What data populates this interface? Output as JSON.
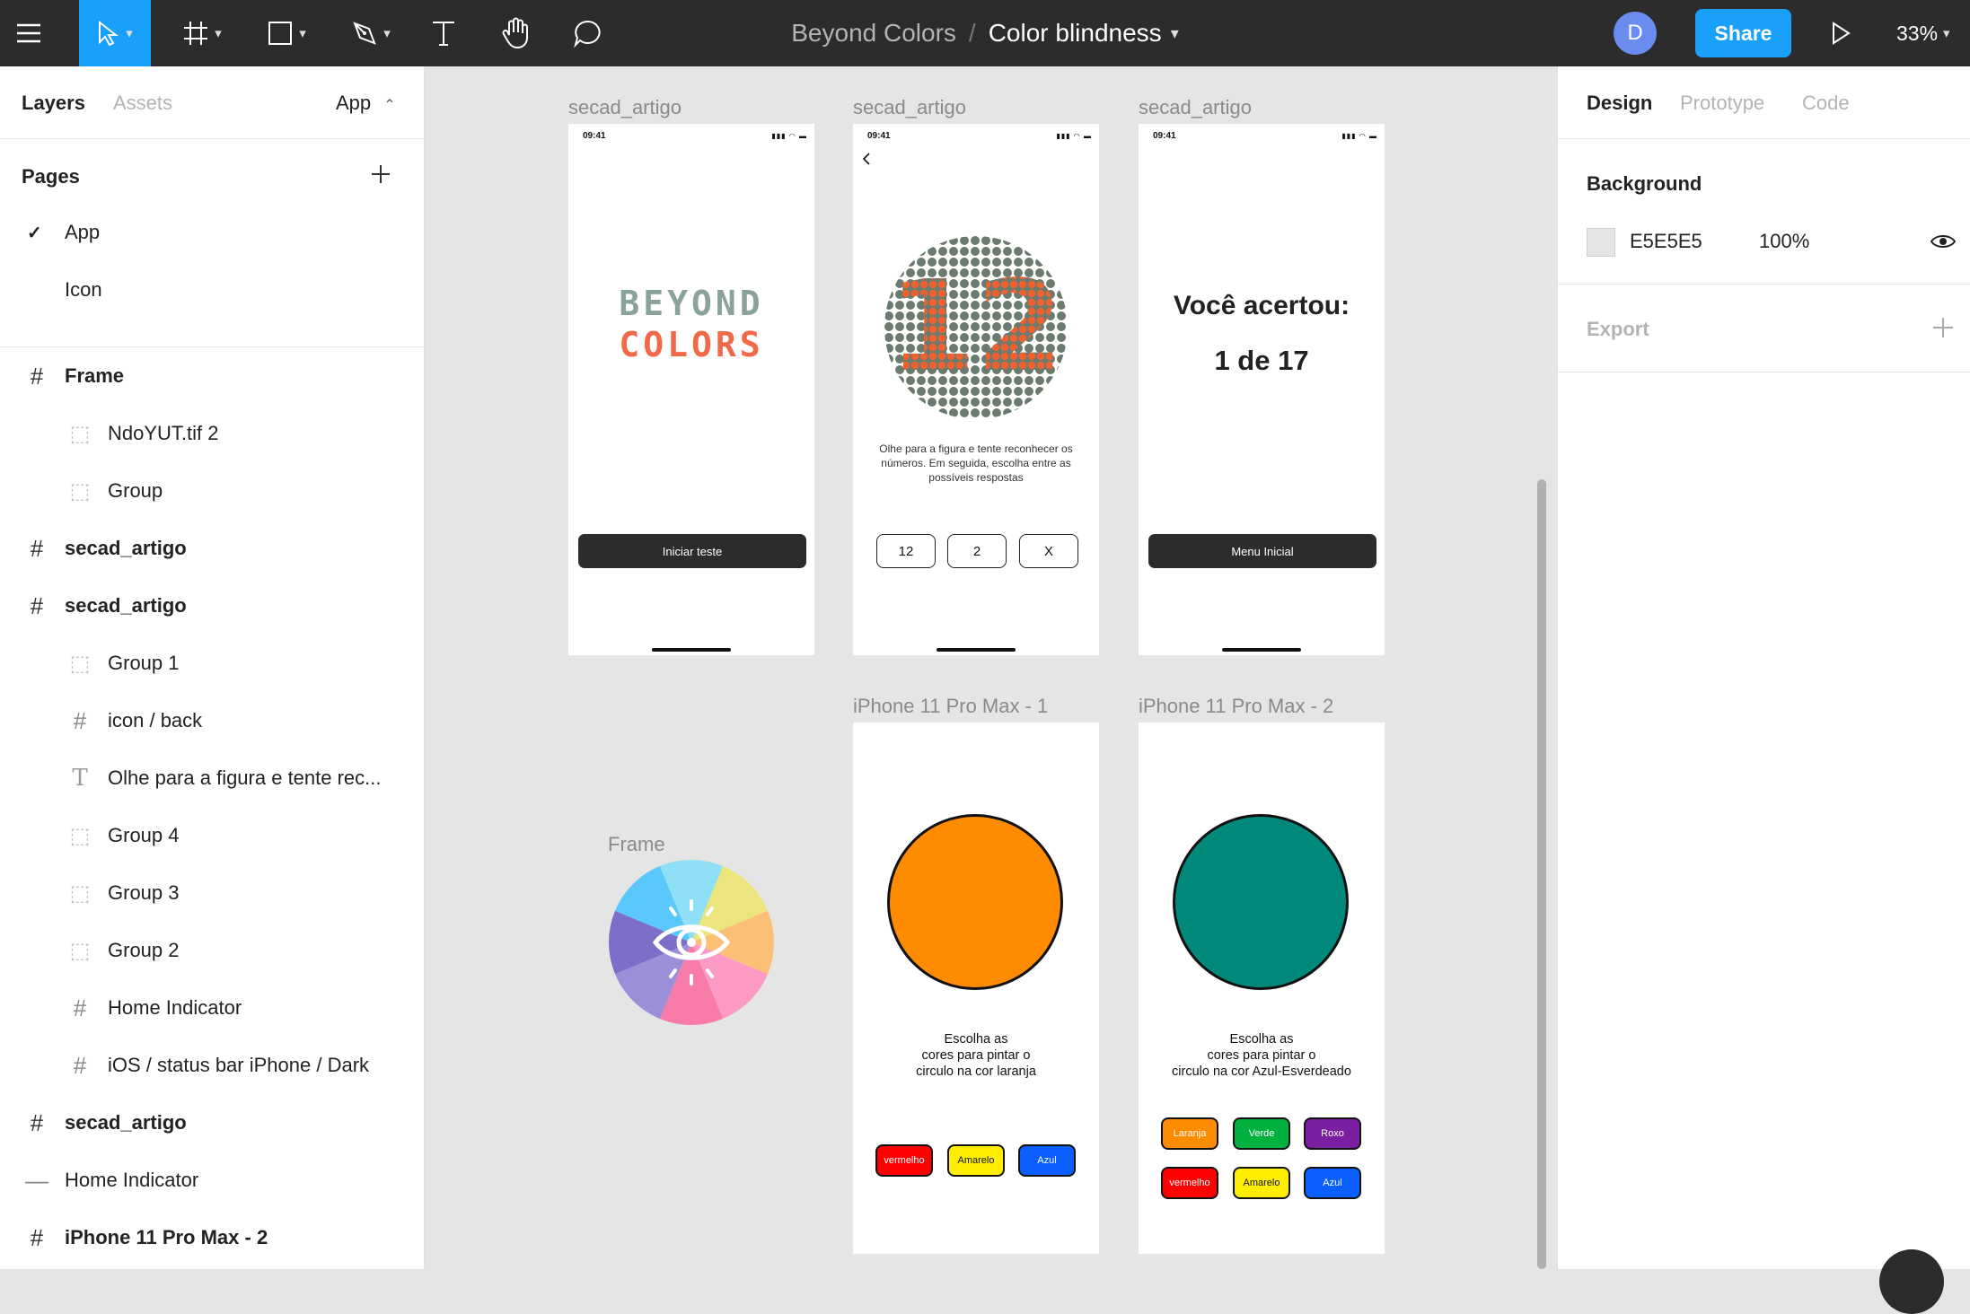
{
  "toolbar": {
    "project": "Beyond Colors",
    "separator": "/",
    "file": "Color blindness",
    "avatar": "D",
    "share": "Share",
    "zoom": "33%"
  },
  "left": {
    "tabs": [
      "Layers",
      "Assets"
    ],
    "page_selector": "App",
    "pages_title": "Pages",
    "pages": [
      {
        "label": "App",
        "checked": true
      },
      {
        "label": "Icon",
        "checked": false
      }
    ],
    "layers": [
      {
        "label": "Frame",
        "icon": "frame",
        "indent": 0,
        "bold": true
      },
      {
        "label": "NdoYUT.tif 2",
        "icon": "group",
        "indent": 1,
        "bold": false
      },
      {
        "label": "Group",
        "icon": "group",
        "indent": 1,
        "bold": false
      },
      {
        "label": "secad_artigo",
        "icon": "frame",
        "indent": 0,
        "bold": true
      },
      {
        "label": "secad_artigo",
        "icon": "frame",
        "indent": 0,
        "bold": true
      },
      {
        "label": "Group 1",
        "icon": "group",
        "indent": 1,
        "bold": false
      },
      {
        "label": "icon / back",
        "icon": "frame",
        "indent": 1,
        "bold": false
      },
      {
        "label": "Olhe para a figura e tente rec...",
        "icon": "text",
        "indent": 1,
        "bold": false
      },
      {
        "label": "Group 4",
        "icon": "group",
        "indent": 1,
        "bold": false
      },
      {
        "label": "Group 3",
        "icon": "group",
        "indent": 1,
        "bold": false
      },
      {
        "label": "Group 2",
        "icon": "group",
        "indent": 1,
        "bold": false
      },
      {
        "label": "Home Indicator",
        "icon": "frame",
        "indent": 1,
        "bold": false
      },
      {
        "label": "iOS / status bar iPhone / Dark",
        "icon": "frame",
        "indent": 1,
        "bold": false
      },
      {
        "label": "secad_artigo",
        "icon": "frame",
        "indent": 0,
        "bold": true
      },
      {
        "label": "Home Indicator",
        "icon": "line",
        "indent": 0,
        "bold": false
      },
      {
        "label": "iPhone 11 Pro Max - 2",
        "icon": "frame",
        "indent": 0,
        "bold": true
      }
    ]
  },
  "right": {
    "tabs": [
      "Design",
      "Prototype",
      "Code"
    ],
    "background_title": "Background",
    "bg_hex": "E5E5E5",
    "bg_opacity": "100%",
    "export_title": "Export"
  },
  "canvas": {
    "frame_labels": [
      "secad_artigo",
      "secad_artigo",
      "secad_artigo",
      "iPhone 11 Pro Max - 1",
      "iPhone 11 Pro Max - 2",
      "Frame"
    ],
    "status_time": "09:41",
    "screen1": {
      "logo_line1": "BEYOND",
      "logo_line2": "COLORS",
      "button": "Iniciar teste"
    },
    "screen2": {
      "plate_number": "12",
      "instructions": "Olhe para a figura e tente reconhecer os números. Em seguida, escolha entre as possíveis respostas",
      "answers": [
        "12",
        "2",
        "X"
      ]
    },
    "screen3": {
      "title": "Você acertou:",
      "score": "1 de 17",
      "button": "Menu Inicial"
    },
    "screen4": {
      "circle_color": "#ff8c00",
      "prompt": [
        "Escolha as",
        "cores para pintar o",
        "circulo na cor laranja"
      ],
      "buttons": [
        {
          "label": "vermelho",
          "color": "#ff0000",
          "text_color": "#ffffff"
        },
        {
          "label": "Amarelo",
          "color": "#ffee00",
          "text_color": "#111111"
        },
        {
          "label": "Azul",
          "color": "#0b5fff",
          "text_color": "#ffffff"
        }
      ]
    },
    "screen5": {
      "circle_color": "#00897b",
      "prompt": [
        "Escolha as",
        "cores para pintar o",
        "circulo na cor Azul-Esverdeado"
      ],
      "buttons": [
        {
          "label": "Laranja",
          "color": "#ff8c00",
          "text_color": "#ffffff"
        },
        {
          "label": "Verde",
          "color": "#00b140",
          "text_color": "#ffffff"
        },
        {
          "label": "Roxo",
          "color": "#7b1fa2",
          "text_color": "#ffffff"
        },
        {
          "label": "vermelho",
          "color": "#ff0000",
          "text_color": "#ffffff"
        },
        {
          "label": "Amarelo",
          "color": "#ffee00",
          "text_color": "#111111"
        },
        {
          "label": "Azul",
          "color": "#0b5fff",
          "text_color": "#ffffff"
        }
      ]
    },
    "wheel_colors": [
      "#8fe0f7",
      "#ece57e",
      "#fbbf75",
      "#fd9bc6",
      "#f77aa8",
      "#9b8fd9",
      "#7b6fc9",
      "#5ac8fa"
    ]
  }
}
